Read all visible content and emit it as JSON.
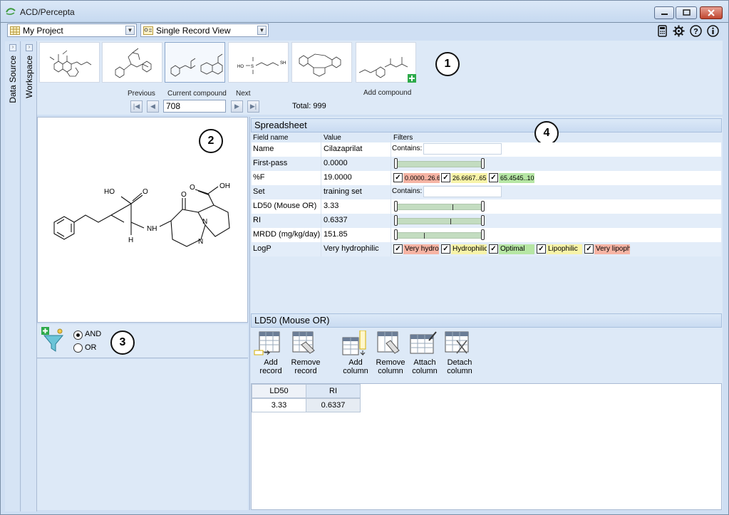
{
  "window": {
    "title": "ACD/Percepta",
    "buttons": [
      "minimize",
      "maximize",
      "close"
    ]
  },
  "toolbar": {
    "project": "My Project",
    "view": "Single Record View",
    "right_icons": [
      "calculator-icon",
      "gear-icon",
      "help-icon",
      "info-icon"
    ]
  },
  "sidebar": {
    "tabs": [
      {
        "label": "Data Source"
      },
      {
        "label": "Workspace"
      }
    ]
  },
  "compound_strip": {
    "badge": "1",
    "add_label": "Add compound",
    "thumbnails": 5,
    "selected_index": 2
  },
  "navigation": {
    "previous_label": "Previous",
    "current_label": "Current compound",
    "next_label": "Next",
    "current_value": "708",
    "total_text": "Total: 999"
  },
  "structure_panel": {
    "badge": "2"
  },
  "filter_panel": {
    "badge": "3",
    "and_label": "AND",
    "or_label": "OR",
    "selected": "AND"
  },
  "spreadsheet": {
    "title": "Spreadsheet",
    "badge": "4",
    "headers": [
      "Field name",
      "Value",
      "Filters"
    ],
    "contains_label": "Contains:",
    "rows": [
      {
        "field": "Name",
        "value": "Cilazaprilat",
        "filter": "contains"
      },
      {
        "field": "First-pass",
        "value": "0.0000",
        "filter": "slider",
        "level": 0.0
      },
      {
        "field": "%F",
        "value": "19.0000",
        "filter": "ranges"
      },
      {
        "field": "Set",
        "value": "training set",
        "filter": "contains"
      },
      {
        "field": "LD50 (Mouse OR)",
        "value": "3.33",
        "filter": "slider",
        "level": 0.65
      },
      {
        "field": "RI",
        "value": "0.6337",
        "filter": "slider",
        "level": 0.62
      },
      {
        "field": "MRDD (mg/kg/day)",
        "value": "151.85",
        "filter": "slider",
        "level": 0.32
      },
      {
        "field": "LogP",
        "value": "Very hydrophilic",
        "filter": "categories"
      }
    ],
    "ranges": [
      {
        "label": "0.0000..26.6",
        "color": "#f6b4a4"
      },
      {
        "label": "26.6667..65",
        "color": "#f7f3a8"
      },
      {
        "label": "65.4545..10",
        "color": "#b6e6a4"
      }
    ],
    "categories": [
      {
        "label": "Very hydro",
        "color": "#f6b4a4"
      },
      {
        "label": "Hydrophilic",
        "color": "#f7f3a8"
      },
      {
        "label": "Optimal",
        "color": "#b6e6a4"
      },
      {
        "label": "Lipophilic",
        "color": "#f7f3a8"
      },
      {
        "label": "Very lipoph",
        "color": "#f6b4a4"
      }
    ]
  },
  "ld50_section": {
    "title": "LD50 (Mouse OR)",
    "tools": [
      {
        "line1": "Add",
        "line2": "record"
      },
      {
        "line1": "Remove",
        "line2": "record"
      },
      {
        "line1": "Add",
        "line2": "column"
      },
      {
        "line1": "Remove",
        "line2": "column"
      },
      {
        "line1": "Attach",
        "line2": "column"
      },
      {
        "line1": "Detach",
        "line2": "column"
      }
    ],
    "table": {
      "headers": [
        "LD50 (Mouse...",
        "RI"
      ],
      "row": [
        "3.33",
        "0.6337"
      ]
    }
  },
  "structure_labels": {
    "ho1": "HO",
    "o1": "O",
    "nh": "NH",
    "h": "H",
    "o2": "O",
    "n1": "N",
    "n2": "N",
    "o3": "O",
    "oh": "OH"
  }
}
